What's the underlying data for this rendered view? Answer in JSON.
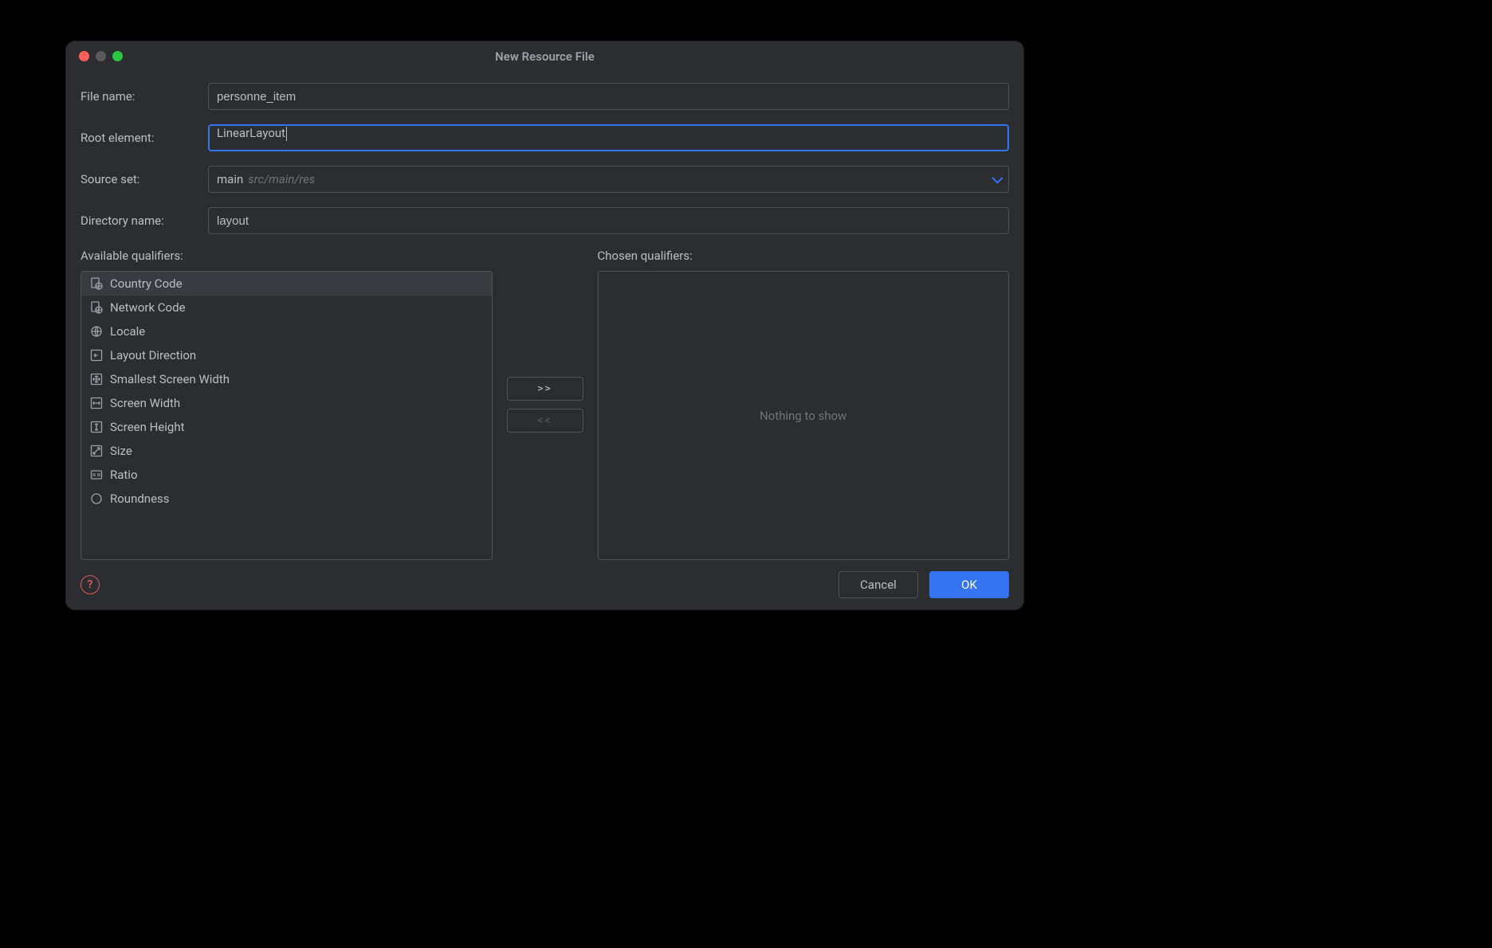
{
  "dialog": {
    "title": "New Resource File",
    "form": {
      "file_name_label": "File name:",
      "file_name_value": "personne_item",
      "root_element_label": "Root element:",
      "root_element_value": "LinearLayout",
      "source_set_label": "Source set:",
      "source_set_value": "main",
      "source_set_hint": "src/main/res",
      "directory_name_label": "Directory name:",
      "directory_name_value": "layout"
    },
    "qualifiers": {
      "available_label": "Available qualifiers:",
      "chosen_label": "Chosen qualifiers:",
      "empty_msg": "Nothing to show",
      "available": [
        {
          "icon": "globe-doc",
          "label": "Country Code",
          "selected": true
        },
        {
          "icon": "globe-doc",
          "label": "Network Code"
        },
        {
          "icon": "globe",
          "label": "Locale"
        },
        {
          "icon": "arrow-left-box",
          "label": "Layout Direction"
        },
        {
          "icon": "resize-box",
          "label": "Smallest Screen Width"
        },
        {
          "icon": "h-resize-box",
          "label": "Screen Width"
        },
        {
          "icon": "v-resize-box",
          "label": "Screen Height"
        },
        {
          "icon": "diag-box",
          "label": "Size"
        },
        {
          "icon": "ratio-box",
          "label": "Ratio"
        },
        {
          "icon": "round",
          "label": "Roundness"
        }
      ]
    },
    "transfer": {
      "add": ">>",
      "remove": "<<"
    },
    "footer": {
      "help": "?",
      "cancel": "Cancel",
      "ok": "OK"
    }
  }
}
